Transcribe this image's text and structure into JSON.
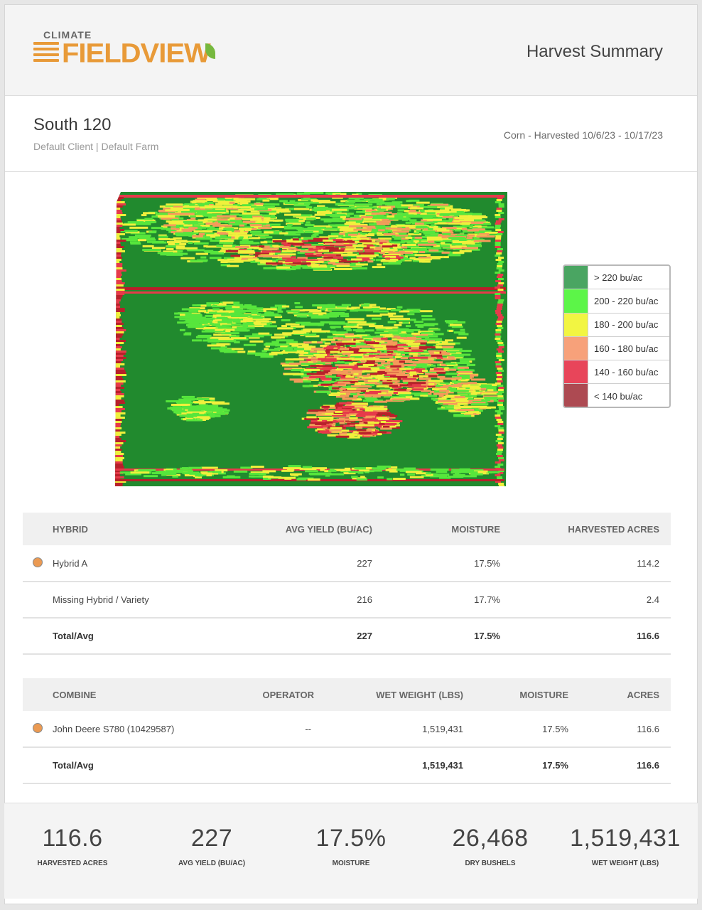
{
  "header": {
    "logo_top": "CLIMATE",
    "logo_main": "FIELDVIEW",
    "title": "Harvest Summary"
  },
  "field": {
    "name": "South 120",
    "subtitle": "Default Client | Default Farm",
    "crop_info": "Corn - Harvested 10/6/23 - 10/17/23"
  },
  "map": {
    "colors": {
      "gt220": "#218a2e",
      "c200_220": "#57e63c",
      "c180_200": "#f0f03c",
      "c160_180": "#f59a5a",
      "c140_160": "#e63a4a",
      "lt140": "#b8202a"
    }
  },
  "legend": [
    {
      "label": "> 220 bu/ac",
      "color": "#4aa562"
    },
    {
      "label": "200 - 220 bu/ac",
      "color": "#5cf548"
    },
    {
      "label": "180 - 200 bu/ac",
      "color": "#f2f542"
    },
    {
      "label": "160 - 180 bu/ac",
      "color": "#f7a17a"
    },
    {
      "label": "140 - 160 bu/ac",
      "color": "#e8455a"
    },
    {
      "label": "< 140 bu/ac",
      "color": "#ad4a52"
    }
  ],
  "hybrid_table": {
    "headers": {
      "hybrid": "HYBRID",
      "avg_yield": "AVG YIELD (BU/AC)",
      "moisture": "MOISTURE",
      "acres": "HARVESTED ACRES"
    },
    "rows": [
      {
        "hybrid": "Hybrid A",
        "avg_yield": "227",
        "moisture": "17.5%",
        "acres": "114.2",
        "dot_color": "#eb9a52"
      },
      {
        "hybrid": "Missing Hybrid / Variety",
        "avg_yield": "216",
        "moisture": "17.7%",
        "acres": "2.4"
      }
    ],
    "total": {
      "label": "Total/Avg",
      "avg_yield": "227",
      "moisture": "17.5%",
      "acres": "116.6"
    }
  },
  "combine_table": {
    "headers": {
      "combine": "COMBINE",
      "operator": "OPERATOR",
      "wet_weight": "WET WEIGHT (LBS)",
      "moisture": "MOISTURE",
      "acres": "ACRES"
    },
    "rows": [
      {
        "combine": "John Deere S780 (10429587)",
        "operator": "--",
        "wet_weight": "1,519,431",
        "moisture": "17.5%",
        "acres": "116.6",
        "dot_color": "#eb9a52"
      }
    ],
    "total": {
      "label": "Total/Avg",
      "wet_weight": "1,519,431",
      "moisture": "17.5%",
      "acres": "116.6"
    }
  },
  "summary": [
    {
      "value": "116.6",
      "label": "HARVESTED ACRES"
    },
    {
      "value": "227",
      "label": "AVG YIELD (BU/AC)"
    },
    {
      "value": "17.5%",
      "label": "MOISTURE"
    },
    {
      "value": "26,468",
      "label": "DRY BUSHELS"
    },
    {
      "value": "1,519,431",
      "label": "WET WEIGHT (LBS)"
    }
  ]
}
